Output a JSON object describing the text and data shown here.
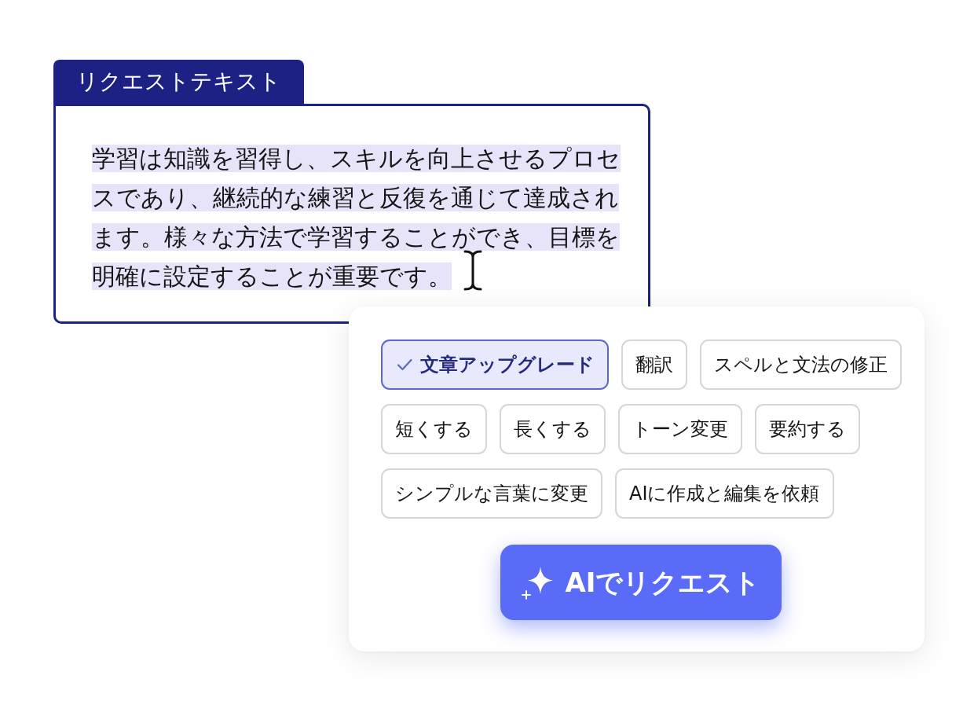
{
  "request_text": {
    "tab_label": "リクエストテキスト",
    "text": "学習は知識を習得し、スキルを向上させるプロセスであり、継続的な練習と反復を通じて達成されます。様々な方法で学習することができ、目標を明確に設定することが重要です。",
    "selected": true
  },
  "actions": {
    "option_rows": [
      [
        {
          "label": "文章アップグレード",
          "selected": true
        },
        {
          "label": "翻訳",
          "selected": false
        },
        {
          "label": "スペルと文法の修正",
          "selected": false
        }
      ],
      [
        {
          "label": "短くする",
          "selected": false
        },
        {
          "label": "長くする",
          "selected": false
        },
        {
          "label": "トーン変更",
          "selected": false
        },
        {
          "label": "要約する",
          "selected": false
        }
      ],
      [
        {
          "label": "シンプルな言葉に変更",
          "selected": false
        },
        {
          "label": "AIに作成と編集を依頼",
          "selected": false
        }
      ]
    ],
    "submit_button": {
      "label": "AIでリクエスト"
    }
  }
}
